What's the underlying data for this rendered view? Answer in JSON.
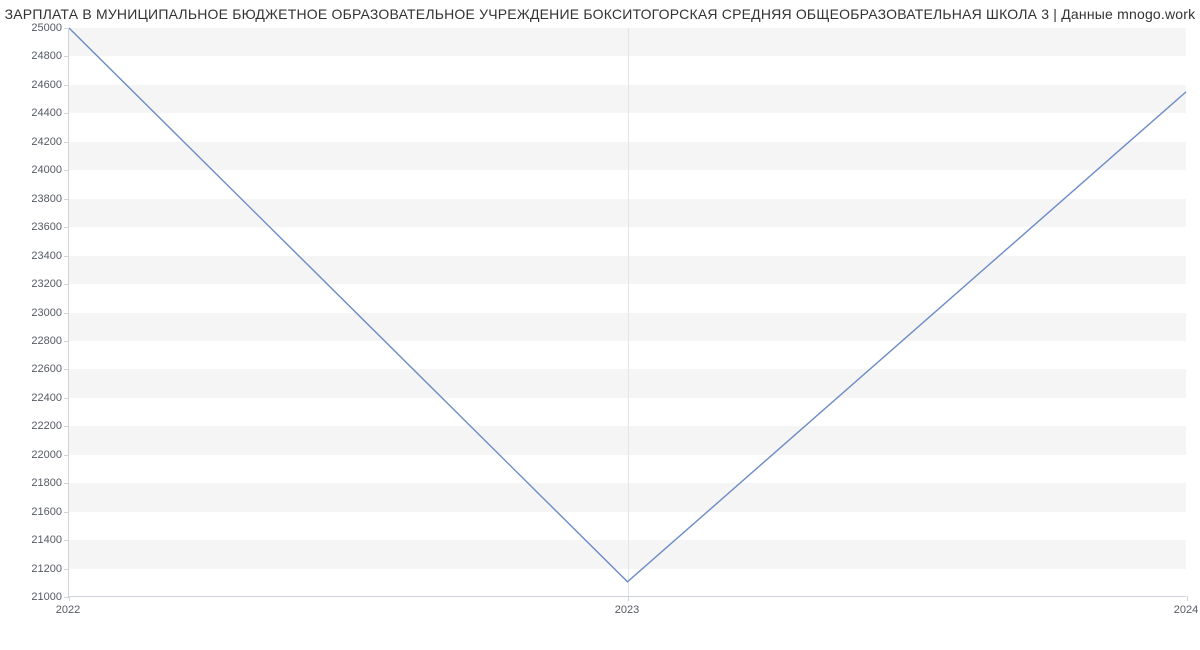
{
  "chart_data": {
    "type": "line",
    "title": "ЗАРПЛАТА В МУНИЦИПАЛЬНОЕ БЮДЖЕТНОЕ ОБРАЗОВАТЕЛЬНОЕ УЧРЕЖДЕНИЕ БОКСИТОГОРСКАЯ СРЕДНЯЯ ОБЩЕОБРАЗОВАТЕЛЬНАЯ ШКОЛА 3 | Данные mnogo.work",
    "x": [
      2022,
      2023,
      2024
    ],
    "values": [
      25000,
      21100,
      24550
    ],
    "x_ticks": [
      2022,
      2023,
      2024
    ],
    "y_ticks": [
      21000,
      21200,
      21400,
      21600,
      21800,
      22000,
      22200,
      22400,
      22600,
      22800,
      23000,
      23200,
      23400,
      23600,
      23800,
      24000,
      24200,
      24400,
      24600,
      24800,
      25000
    ],
    "xlim": [
      2022,
      2024
    ],
    "ylim": [
      21000,
      25000
    ],
    "xlabel": "",
    "ylabel": "",
    "grid": {
      "y_bands": true,
      "x_lines": true
    },
    "colors": {
      "line": "#6b8bc8",
      "band": "#f5f5f5"
    }
  }
}
